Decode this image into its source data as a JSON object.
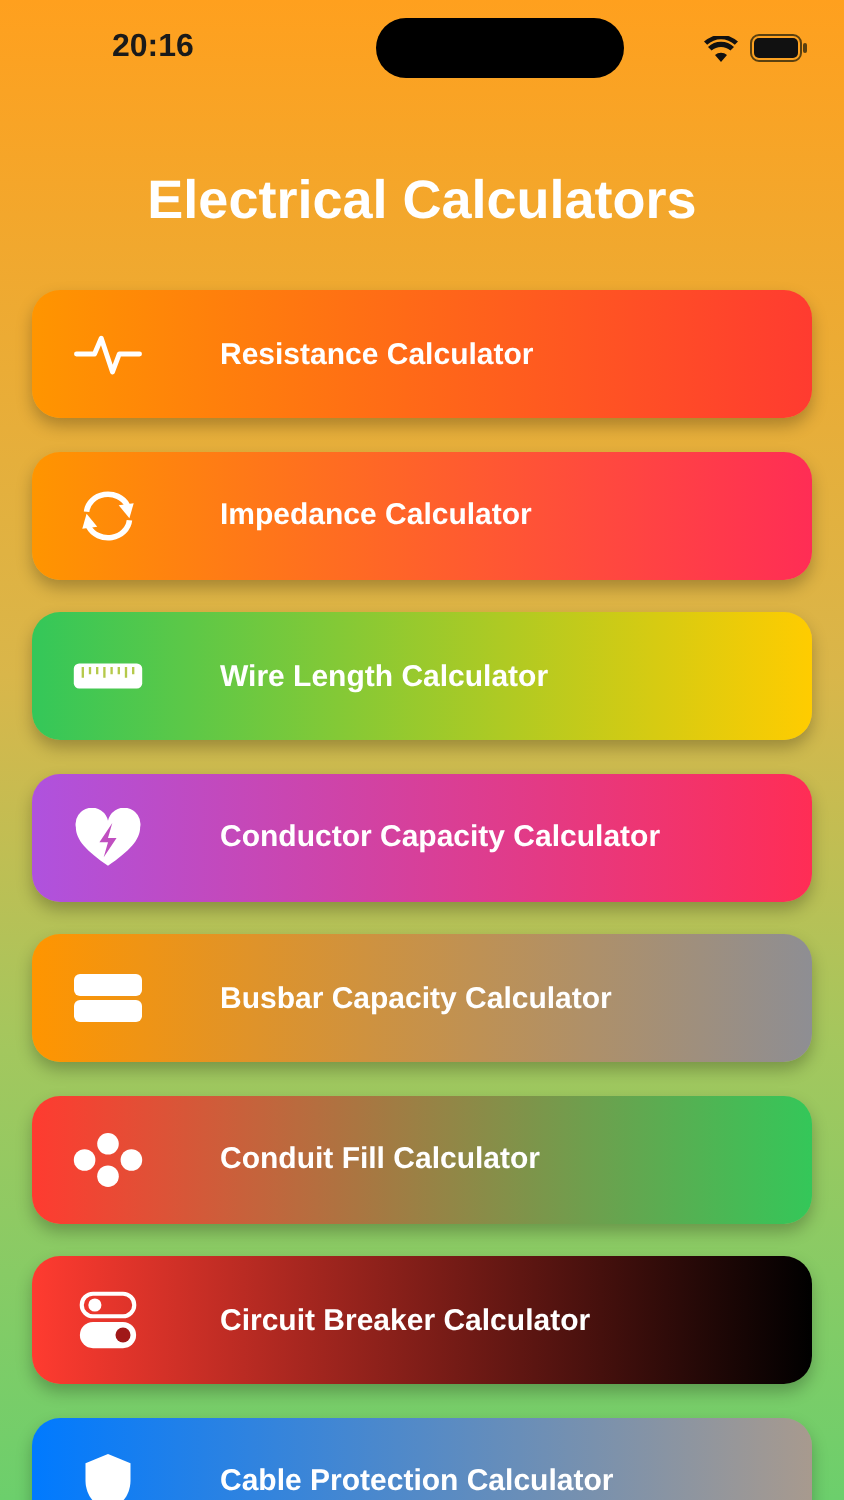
{
  "status_bar": {
    "time": "20:16"
  },
  "title": "Electrical Calculators",
  "calculators": [
    {
      "label": "Resistance Calculator",
      "gradient": [
        {
          "color": "#ff9500"
        },
        {
          "color": "#ff3b30"
        }
      ]
    },
    {
      "label": "Impedance Calculator",
      "gradient": [
        {
          "color": "#ff9500"
        },
        {
          "color": "#ff2d55"
        }
      ]
    },
    {
      "label": "Wire Length Calculator",
      "gradient": [
        {
          "color": "#34c759"
        },
        {
          "color": "#ffcc00"
        }
      ]
    },
    {
      "label": "Conductor Capacity Calculator",
      "gradient": [
        {
          "color": "#af52de"
        },
        {
          "color": "#ff2d55"
        }
      ]
    },
    {
      "label": "Busbar Capacity Calculator",
      "gradient": [
        {
          "color": "#ff9500"
        },
        {
          "color": "#8e8e93"
        }
      ]
    },
    {
      "label": "Conduit Fill Calculator",
      "gradient": [
        {
          "color": "#ff3b30"
        },
        {
          "color": "#34c759"
        }
      ]
    },
    {
      "label": "Circuit Breaker Calculator",
      "gradient": [
        {
          "color": "#ff3b30"
        },
        {
          "color": "#000000"
        }
      ]
    },
    {
      "label": "Cable Protection Calculator",
      "gradient": [
        {
          "color": "#007aff"
        },
        {
          "color": "#a89a8e"
        }
      ]
    }
  ]
}
